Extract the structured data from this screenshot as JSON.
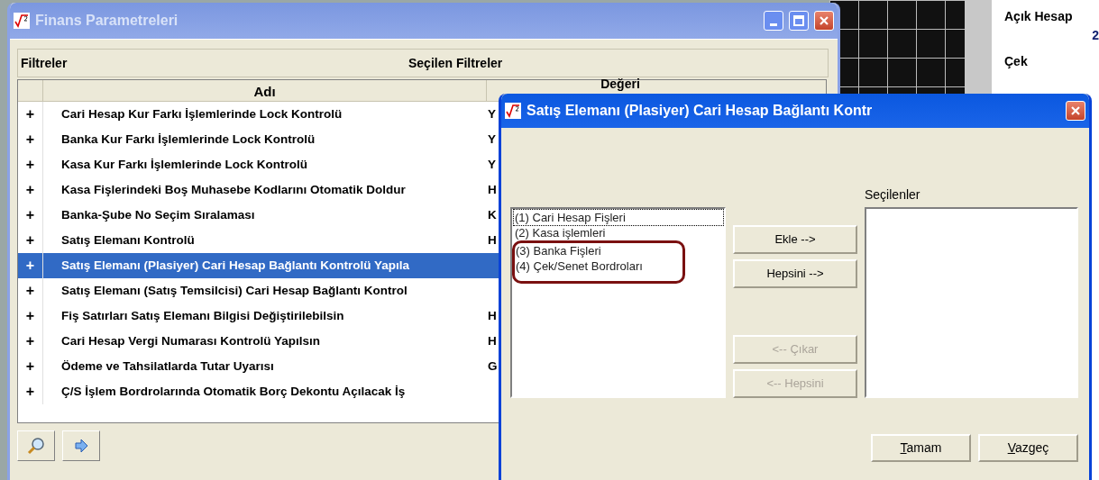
{
  "background": {
    "labels": [
      {
        "text": "Açık Hesap",
        "kind": "label"
      },
      {
        "text": "2",
        "kind": "value"
      },
      {
        "text": "Çek",
        "kind": "label"
      }
    ]
  },
  "main_window": {
    "title": "Finans Parametreleri",
    "active": false,
    "filters_label": "Filtreler",
    "selected_filters_label": "Seçilen Filtreler",
    "table": {
      "columns": [
        "Adı",
        "Değeri"
      ],
      "rows": [
        {
          "expander": "+",
          "name": "Cari Hesap Kur Farkı İşlemlerinde Lock Kontrolü",
          "value": "Y",
          "selected": false
        },
        {
          "expander": "+",
          "name": "Banka Kur Farkı İşlemlerinde Lock Kontrolü",
          "value": "Y",
          "selected": false
        },
        {
          "expander": "+",
          "name": "Kasa Kur Farkı İşlemlerinde Lock Kontrolü",
          "value": "Y",
          "selected": false
        },
        {
          "expander": "+",
          "name": "Kasa Fişlerindeki Boş Muhasebe Kodlarını Otomatik Doldur",
          "value": "H",
          "selected": false
        },
        {
          "expander": "+",
          "name": "Banka-Şube No Seçim Sıralaması",
          "value": "K",
          "selected": false
        },
        {
          "expander": "+",
          "name": "Satış Elemanı Kontrolü",
          "value": "H",
          "selected": false
        },
        {
          "expander": "+",
          "name": "Satış Elemanı (Plasiyer) Cari Hesap Bağlantı Kontrolü Yapıla",
          "selected": true
        },
        {
          "expander": "+",
          "name": "Satış Elemanı (Satış Temsilcisi) Cari Hesap Bağlantı Kontrol",
          "selected": false
        },
        {
          "expander": "+",
          "name": "Fiş Satırları Satış Elemanı Bilgisi Değiştirilebilsin",
          "value": "H",
          "selected": false
        },
        {
          "expander": "+",
          "name": "Cari Hesap Vergi Numarası Kontrolü Yapılsın",
          "value": "H",
          "selected": false
        },
        {
          "expander": "+",
          "name": "Ödeme ve Tahsilatlarda Tutar Uyarısı",
          "value": "G",
          "selected": false
        },
        {
          "expander": "+",
          "name": "Ç/S İşlem Bordrolarında Otomatik Borç Dekontu Açılacak İş",
          "selected": false
        }
      ]
    }
  },
  "dialog": {
    "title": "Satış Elemanı (Plasiyer) Cari Hesap Bağlantı Kontr",
    "active": true,
    "available": [
      {
        "label": "(1) Cari Hesap Fişleri",
        "focused": true,
        "annotated": false
      },
      {
        "label": "(2) Kasa işlemleri",
        "focused": false,
        "annotated": false
      },
      {
        "label": "(3) Banka Fişleri",
        "focused": false,
        "annotated": true
      },
      {
        "label": "(4) Çek/Senet Bordroları",
        "focused": false,
        "annotated": true
      }
    ],
    "selected_label": "Seçilenler",
    "move_buttons": [
      {
        "label": "Ekle -->",
        "disabled": false
      },
      {
        "label": "Hepsini -->",
        "disabled": false
      },
      {
        "label": "<-- Çıkar",
        "disabled": true
      },
      {
        "label": "<-- Hepsini",
        "disabled": true
      }
    ],
    "footer_buttons": [
      {
        "label": "Tamam",
        "underline_first": true
      },
      {
        "label": "Vazgeç",
        "underline_first": true
      }
    ]
  }
}
